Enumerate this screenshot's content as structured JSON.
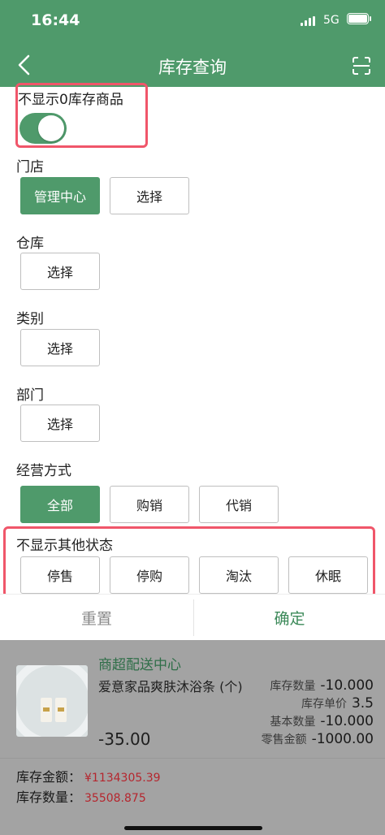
{
  "status": {
    "time": "16:44",
    "network": "5G"
  },
  "nav": {
    "title": "库存查询"
  },
  "filters": {
    "hide_zero_label": "不显示0库存商品",
    "store_label": "门店",
    "store_options": [
      "管理中心",
      "选择"
    ],
    "warehouse_label": "仓库",
    "warehouse_btn": "选择",
    "category_label": "类别",
    "category_btn": "选择",
    "dept_label": "部门",
    "dept_btn": "选择",
    "mode_label": "经营方式",
    "mode_options": [
      "全部",
      "购销",
      "代销"
    ],
    "hide_status_label": "不显示其他状态",
    "status_options": [
      "停售",
      "停购",
      "淘汰",
      "休眠"
    ]
  },
  "actions": {
    "reset": "重置",
    "confirm": "确定"
  },
  "item": {
    "store": "商超配送中心",
    "name": "爱意家品爽肤沐浴条 (个)",
    "price": "-35.00",
    "fields": [
      {
        "k": "库存数量",
        "v": "-10.000"
      },
      {
        "k": "库存单价",
        "v": "3.5"
      },
      {
        "k": "基本数量",
        "v": "-10.000"
      },
      {
        "k": "零售金额",
        "v": "-1000.00"
      }
    ]
  },
  "summary": {
    "amount_label": "库存金额：",
    "amount_value": "¥1134305.39",
    "qty_label": "库存数量：",
    "qty_value": "35508.875"
  },
  "colors": {
    "primary": "#4f9a6b",
    "highlight": "#f0566a",
    "money": "#b5262e"
  }
}
